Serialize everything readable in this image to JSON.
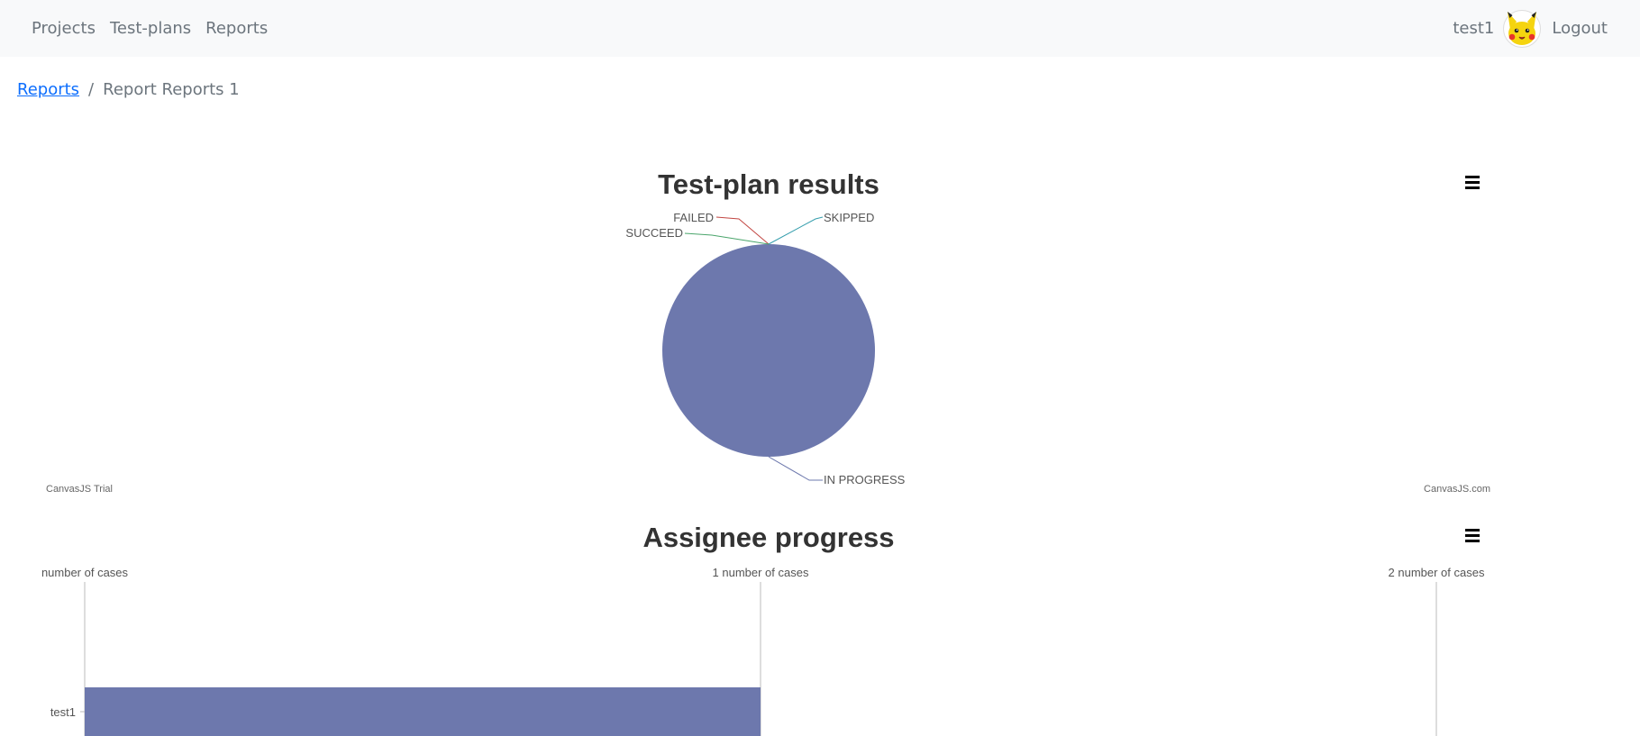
{
  "nav": {
    "links": [
      "Projects",
      "Test-plans",
      "Reports"
    ],
    "username": "test1",
    "logout_label": "Logout",
    "avatar_icon": "pikachu-avatar-icon"
  },
  "breadcrumb": {
    "parent": "Reports",
    "separator": "/",
    "current": "Report Reports 1"
  },
  "chart_data": [
    {
      "type": "pie",
      "title": "Test-plan results",
      "slices": [
        {
          "label": "FAILED",
          "value": 0,
          "color": "#c24642"
        },
        {
          "label": "SKIPPED",
          "value": 0,
          "color": "#369ead"
        },
        {
          "label": "SUCCEED",
          "value": 0,
          "color": "#4aa56b"
        },
        {
          "label": "IN PROGRESS",
          "value": 1,
          "color": "#6d78ad"
        }
      ],
      "menu_icon": "hamburger-menu-icon",
      "credits": {
        "left": "CanvasJS Trial",
        "right": "CanvasJS.com"
      }
    },
    {
      "type": "bar",
      "orientation": "horizontal",
      "title": "Assignee progress",
      "categories": [
        "test1"
      ],
      "values": [
        1
      ],
      "xlim": [
        0,
        2
      ],
      "tick_labels": [
        "number of cases",
        "1 number of cases",
        "2 number of cases"
      ],
      "bar_color": "#6d78ad",
      "grid": true,
      "menu_icon": "hamburger-menu-icon"
    }
  ]
}
